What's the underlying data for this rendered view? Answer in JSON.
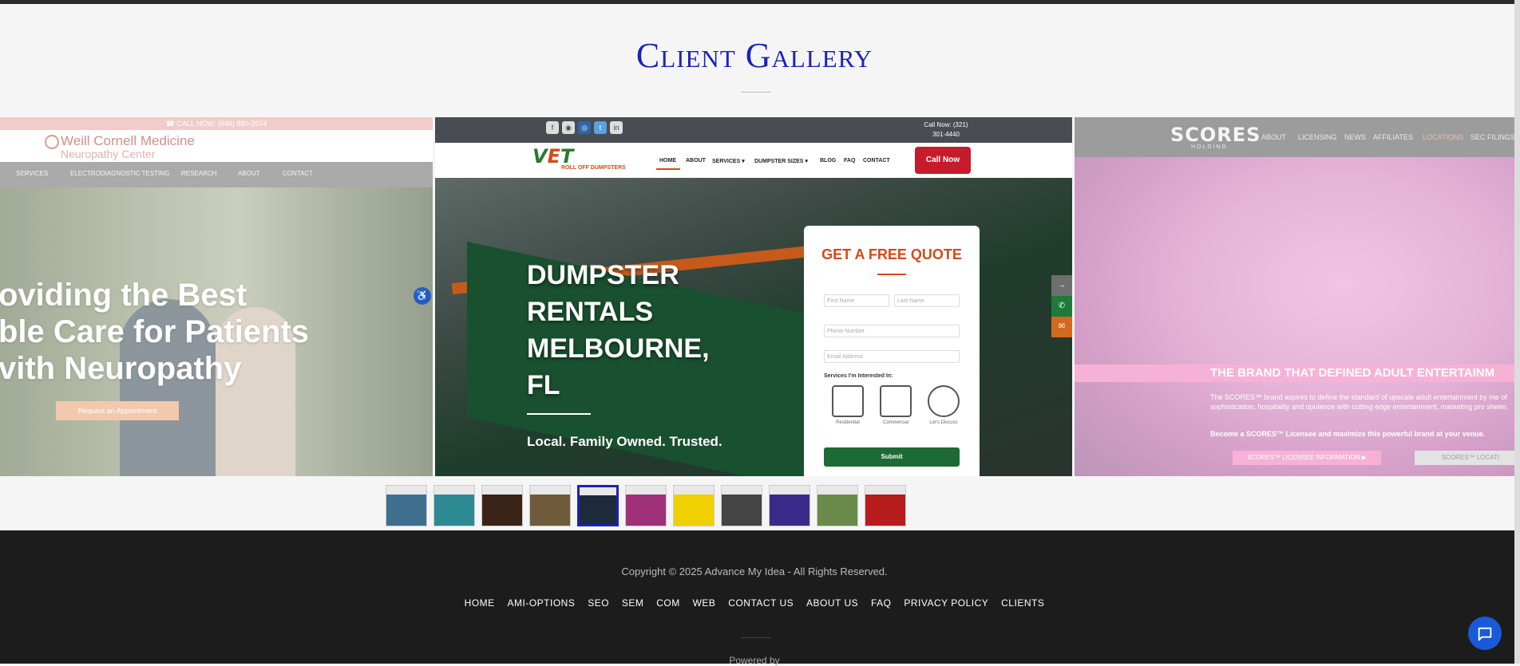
{
  "page": {
    "title": "Client Gallery"
  },
  "slides": {
    "weill": {
      "call": "☎ CALL NOW: (646) 880-2074",
      "logo_line1": "Weill Cornell Medicine",
      "logo_line2": "Neuropathy Center",
      "nav": [
        "SERVICES",
        "ELECTRODIAGNOSTIC TESTING",
        "RESEARCH",
        "ABOUT",
        "CONTACT"
      ],
      "hero_lines": [
        "oviding the Best",
        "ble Care for Patients",
        "vith Neuropathy"
      ],
      "cta": "Request an Appointment"
    },
    "vet": {
      "call_top": "Call Now: (321)\n301-4440",
      "logo": "VET",
      "logo_sub": "ROLL OFF DUMPSTERS",
      "nav": [
        "HOME",
        "ABOUT",
        "SERVICES ▾",
        "DUMPSTER SIZES ▾",
        "BLOG",
        "FAQ",
        "CONTACT"
      ],
      "call_button": "Call Now",
      "hero_lines": [
        "DUMPSTER",
        "RENTALS",
        "MELBOURNE,",
        "FL"
      ],
      "tagline": "Local. Family Owned. Trusted.",
      "quote": {
        "title": "GET A FREE QUOTE",
        "first_name": "First Name",
        "last_name": "Last Name",
        "phone": "Phone Number",
        "email": "Email Address",
        "interest_label": "Services I'm Interested In:",
        "options": [
          "Residential",
          "Commercial",
          "Let's Discuss"
        ],
        "submit": "Submit"
      }
    },
    "scores": {
      "logo": "SCORES",
      "logo_sub": "HOLDING",
      "nav": [
        "ABOUT",
        "LICENSING",
        "NEWS",
        "AFFILIATES",
        "LOCATIONS",
        "SEC FILINGS"
      ],
      "brand": "THE BRAND THAT DEFINED ADULT ENTERTAINM",
      "para": "The SCORES™ brand aspires to define the standard of upscale adult entertainment by me of sophistication, hospitality and opulence with cutting edge entertainment, marketing pro sheen.",
      "para2": "Become a SCORES™ Licensee and maximize this powerful brand at your venue.",
      "btn1": "SCORES™ LICENSEE INFORMATION ▶",
      "btn2": "SCORES™ LOCATI"
    }
  },
  "thumbnails": [
    {
      "color": "#3f6f8f"
    },
    {
      "color": "#2d8a93"
    },
    {
      "color": "#3a2418"
    },
    {
      "color": "#6f5a3a"
    },
    {
      "color": "#1d2a3a",
      "active": true
    },
    {
      "color": "#a0307a"
    },
    {
      "color": "#f0d000"
    },
    {
      "color": "#444444"
    },
    {
      "color": "#3a2a8a"
    },
    {
      "color": "#6a8a4a"
    },
    {
      "color": "#b71c1c"
    }
  ],
  "footer": {
    "copyright": "Copyright © 2025 Advance My Idea - All Rights Reserved.",
    "nav": [
      "HOME",
      "AMI-OPTIONS",
      "SEO",
      "SEM",
      "COM",
      "WEB",
      "CONTACT US",
      "ABOUT US",
      "FAQ",
      "PRIVACY POLICY",
      "CLIENTS"
    ],
    "powered_by": "Powered by"
  },
  "icons": {
    "chat": "chat-icon",
    "accessibility": "accessibility-icon"
  },
  "colors": {
    "title": "#1b22b8",
    "footer_bg": "#1c1c1c",
    "chat": "#1a5ad8"
  }
}
